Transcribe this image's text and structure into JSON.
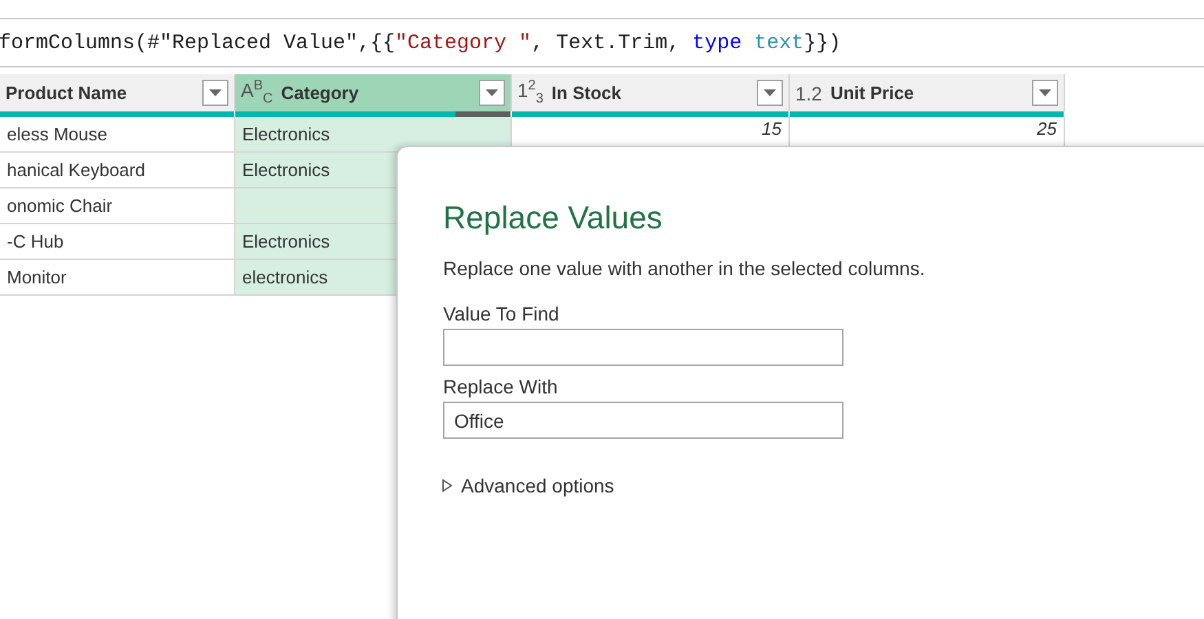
{
  "formula_bar": {
    "tokens": [
      {
        "kind": "plain",
        "text": "formColumns(#\"Replaced Value\",{{"
      },
      {
        "kind": "string",
        "text": "\"Category \""
      },
      {
        "kind": "plain",
        "text": ", Text.Trim, "
      },
      {
        "kind": "keyword",
        "text": "type "
      },
      {
        "kind": "type",
        "text": "text"
      },
      {
        "kind": "plain",
        "text": "}})"
      }
    ]
  },
  "table": {
    "columns": [
      {
        "name": "Product Name",
        "selected": false,
        "quality": {
          "level": 1
        }
      },
      {
        "name": "Category",
        "type_label": "A$^{B}$$_{C}$",
        "selected": true,
        "quality": {
          "level": 0.8
        }
      },
      {
        "name": "In Stock",
        "type_label": "1$^{2}$$_{3}$",
        "selected": false,
        "quality": {
          "level": 1
        }
      },
      {
        "name": "Unit Price",
        "type_label": "1.2",
        "selected": false,
        "quality": {
          "level": 1
        }
      }
    ],
    "rows": [
      {
        "cells": [
          "eless Mouse",
          "Electronics",
          "15",
          "25"
        ]
      },
      {
        "cells": [
          "hanical Keyboard",
          "Electronics"
        ]
      },
      {
        "cells": [
          "onomic Chair"
        ]
      },
      {
        "cells": [
          "-C Hub",
          "Electronics"
        ]
      },
      {
        "cells": [
          "Monitor",
          "electronics"
        ]
      }
    ]
  },
  "dialog": {
    "title": "Replace Values",
    "description": "Replace one value with another in the selected columns.",
    "fields": [
      {
        "label": "Value To Find"
      },
      {
        "label": "Replace With",
        "value": "Office"
      }
    ],
    "advanced": {
      "label": "Advanced options",
      "expanded": false
    }
  }
}
